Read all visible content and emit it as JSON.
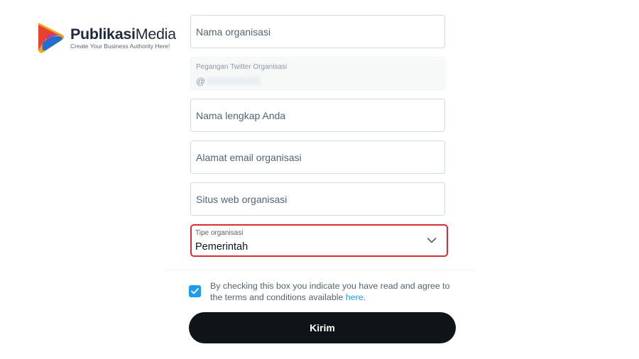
{
  "logo": {
    "name_bold": "Publikasi",
    "name_regular": "Media",
    "tagline": "Create Your Business Authority Here!"
  },
  "form": {
    "org_name": {
      "placeholder": "Nama organisasi"
    },
    "twitter_handle": {
      "label": "Pegangan Twitter Organisasi",
      "prefix": "@"
    },
    "full_name": {
      "placeholder": "Nama lengkap Anda"
    },
    "org_email": {
      "placeholder": "Alamat email organisasi"
    },
    "org_website": {
      "placeholder": "Situs web organisasi"
    },
    "org_type": {
      "label": "Tipe organisasi",
      "value": "Pemerintah"
    },
    "agreement": {
      "checked": true,
      "text": "By checking this box you indicate you have read and agree to the terms and conditions available ",
      "link": "here",
      "suffix": "."
    },
    "submit_label": "Kirim"
  },
  "colors": {
    "accent": "#1d9bf0",
    "highlight_border": "#d62d33",
    "button_bg": "#0f1419"
  }
}
